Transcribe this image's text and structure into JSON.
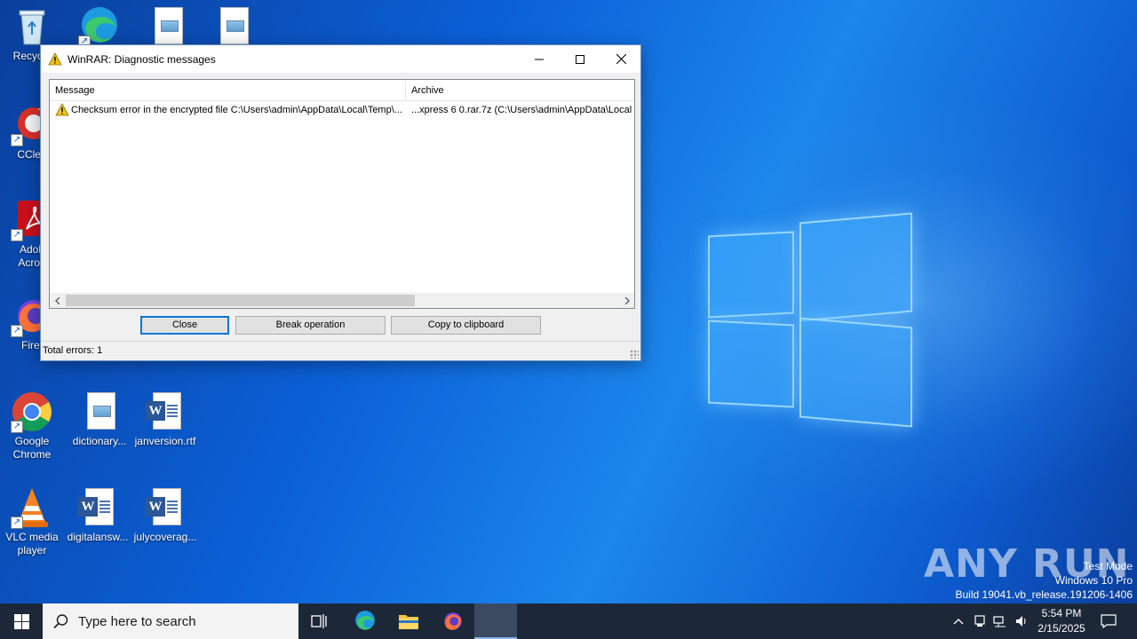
{
  "desktop": {
    "icons": [
      {
        "label": "Recycle",
        "icon": "recycle-bin-icon"
      },
      {
        "label": "",
        "icon": "edge-icon"
      },
      {
        "label": "",
        "icon": "image-file-icon"
      },
      {
        "label": "",
        "icon": "image-file-icon"
      },
      {
        "label": "CClea",
        "icon": "ccleaner-icon"
      },
      {
        "label": "Adob Acrob",
        "icon": "acrobat-icon"
      },
      {
        "label": "Firef",
        "icon": "firefox-icon"
      },
      {
        "label": "Google Chrome",
        "icon": "chrome-icon"
      },
      {
        "label": "dictionary...",
        "icon": "image-file-icon"
      },
      {
        "label": "janversion.rtf",
        "icon": "word-doc-icon"
      },
      {
        "label": "VLC media player",
        "icon": "vlc-icon"
      },
      {
        "label": "digitalansw...",
        "icon": "word-doc-icon"
      },
      {
        "label": "julycoverag...",
        "icon": "word-doc-icon"
      }
    ]
  },
  "dialog": {
    "title": "WinRAR: Diagnostic messages",
    "columns": {
      "message": "Message",
      "archive": "Archive"
    },
    "rows": [
      {
        "message": "Checksum error in the encrypted file C:\\Users\\admin\\AppData\\Local\\Temp\\...",
        "archive": "...xpress 6 0.rar.7z (C:\\Users\\admin\\AppData\\Local"
      }
    ],
    "buttons": {
      "close": "Close",
      "break": "Break operation",
      "copy": "Copy to clipboard"
    },
    "status": "Total errors: 1"
  },
  "watermark": {
    "brand": "ANY RUN",
    "line1": "Test Mode",
    "line2": "Windows 10 Pro",
    "line3": "Build 19041.vb_release.191206-1406"
  },
  "taskbar": {
    "search_placeholder": "Type here to search",
    "time": "5:54 PM",
    "date": "2/15/2025"
  },
  "colors": {
    "accent": "#0078d7",
    "taskbar": "#1c2838",
    "warning": "#f0c419"
  }
}
